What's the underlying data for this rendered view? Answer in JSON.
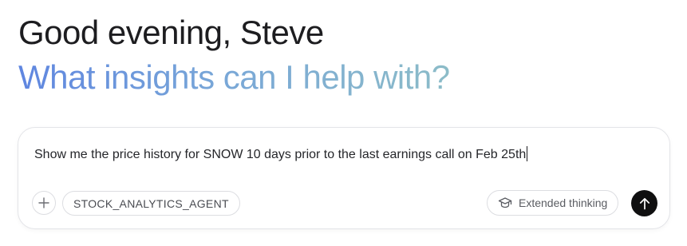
{
  "header": {
    "greeting": "Good evening, Steve",
    "subtitle": "What insights can I help with?"
  },
  "composer": {
    "input_value": "Show me the price history for SNOW 10 days prior to the last earnings call on Feb 25th",
    "add_icon": "plus-icon",
    "agent_chip_label": "STOCK_ANALYTICS_AGENT",
    "thinking_label": "Extended thinking",
    "thinking_icon": "graduation-cap-icon",
    "send_icon": "arrow-up-icon"
  },
  "colors": {
    "greeting": "#1d1d20",
    "subtitle_gradient_start": "#5f86e0",
    "subtitle_gradient_end": "#8cbcc8",
    "send_button": "#0f0f10"
  }
}
